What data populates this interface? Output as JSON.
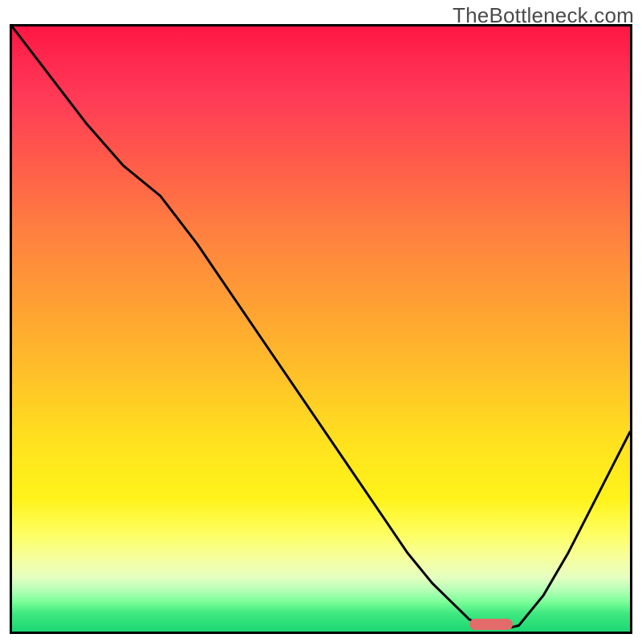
{
  "watermark": "TheBottleneck.com",
  "chart_data": {
    "type": "line",
    "title": "",
    "xlabel": "",
    "ylabel": "",
    "xlim": [
      0,
      100
    ],
    "ylim": [
      0,
      100
    ],
    "grid": false,
    "series": [
      {
        "name": "bottleneck-curve",
        "x": [
          0,
          6,
          12,
          18,
          24,
          30,
          36,
          42,
          48,
          54,
          60,
          64,
          68,
          72,
          74,
          76,
          78,
          80,
          82,
          86,
          90,
          94,
          98,
          100
        ],
        "y": [
          100,
          92,
          84,
          77,
          72,
          64,
          55,
          46,
          37,
          28,
          19,
          13,
          8,
          4,
          2,
          1,
          0.5,
          0.5,
          1,
          6,
          13,
          21,
          29,
          33
        ]
      }
    ],
    "marker": {
      "name": "optimal-range",
      "x_start": 74,
      "x_end": 81,
      "y": 1.2,
      "color": "#e36b6b"
    },
    "background_gradient": {
      "top": "#ff1744",
      "mid": "#ffe01f",
      "bottom": "#1bd873"
    }
  }
}
